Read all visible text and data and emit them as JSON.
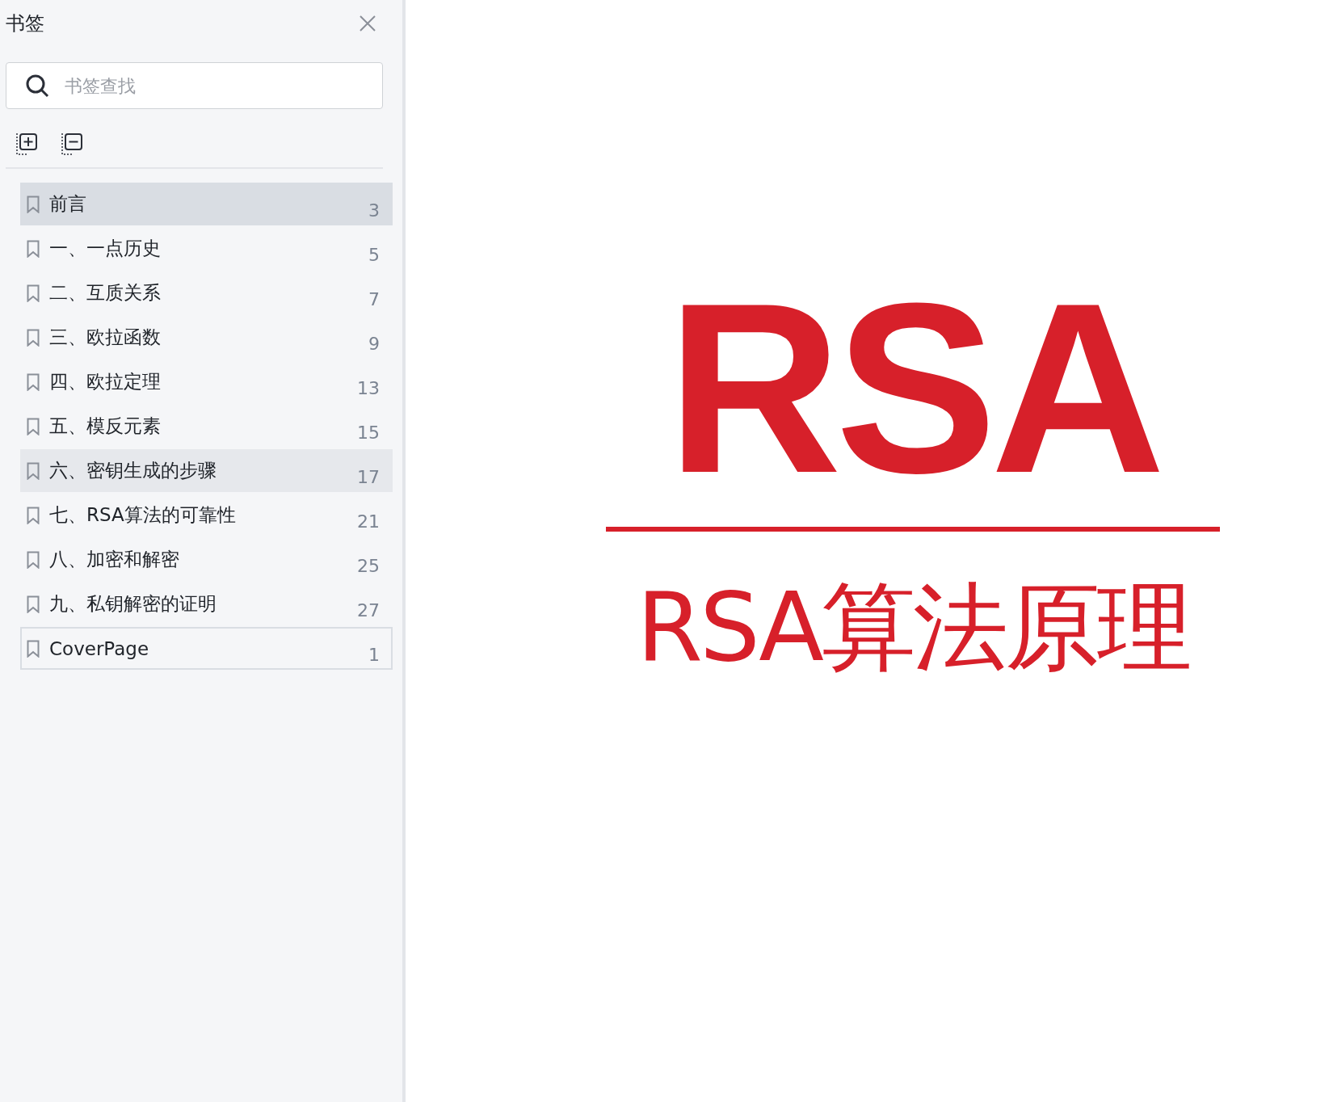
{
  "sidebar": {
    "title": "书签",
    "search": {
      "placeholder": "书签查找"
    },
    "bookmarks": [
      {
        "label": "前言",
        "page": "3",
        "selected": true,
        "hovered": false,
        "focused": false
      },
      {
        "label": "一、一点历史",
        "page": "5",
        "selected": false,
        "hovered": false,
        "focused": false
      },
      {
        "label": "二、互质关系",
        "page": "7",
        "selected": false,
        "hovered": false,
        "focused": false
      },
      {
        "label": "三、欧拉函数",
        "page": "9",
        "selected": false,
        "hovered": false,
        "focused": false
      },
      {
        "label": "四、欧拉定理",
        "page": "13",
        "selected": false,
        "hovered": false,
        "focused": false
      },
      {
        "label": "五、模反元素",
        "page": "15",
        "selected": false,
        "hovered": false,
        "focused": false
      },
      {
        "label": "六、密钥生成的步骤",
        "page": "17",
        "selected": false,
        "hovered": true,
        "focused": false
      },
      {
        "label": "七、RSA算法的可靠性",
        "page": "21",
        "selected": false,
        "hovered": false,
        "focused": false
      },
      {
        "label": "八、加密和解密",
        "page": "25",
        "selected": false,
        "hovered": false,
        "focused": false
      },
      {
        "label": "九、私钥解密的证明",
        "page": "27",
        "selected": false,
        "hovered": false,
        "focused": false
      },
      {
        "label": "CoverPage",
        "page": "1",
        "selected": false,
        "hovered": false,
        "focused": true
      }
    ]
  },
  "document": {
    "logo_text": "RSA",
    "title": "RSA算法原理"
  }
}
